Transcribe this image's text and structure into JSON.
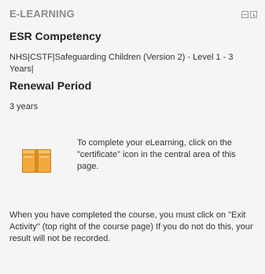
{
  "block": {
    "title": "E-LEARNING",
    "controls": {
      "hide_icon": "hide-block-icon",
      "dock_icon": "dock-block-icon"
    }
  },
  "esr": {
    "heading": "ESR Competency",
    "value": "NHS|CSTF|Safeguarding Children (Version 2) - Level 1 - 3 Years|"
  },
  "renewal": {
    "heading": "Renewal Period",
    "value": "3 years"
  },
  "info": {
    "icon": "certificate-icon",
    "text": "To complete your eLearning, click on the \"certificate\" icon in the central area of this page."
  },
  "note": {
    "text": "When you have completed the course, you must click on \"Exit Activity\" (top right of the course page) If you do not do this, your result will not be recorded."
  },
  "colors": {
    "background": "#f5f5f5",
    "title": "#8a8a8a",
    "icon_orange": "#f2a93b"
  }
}
